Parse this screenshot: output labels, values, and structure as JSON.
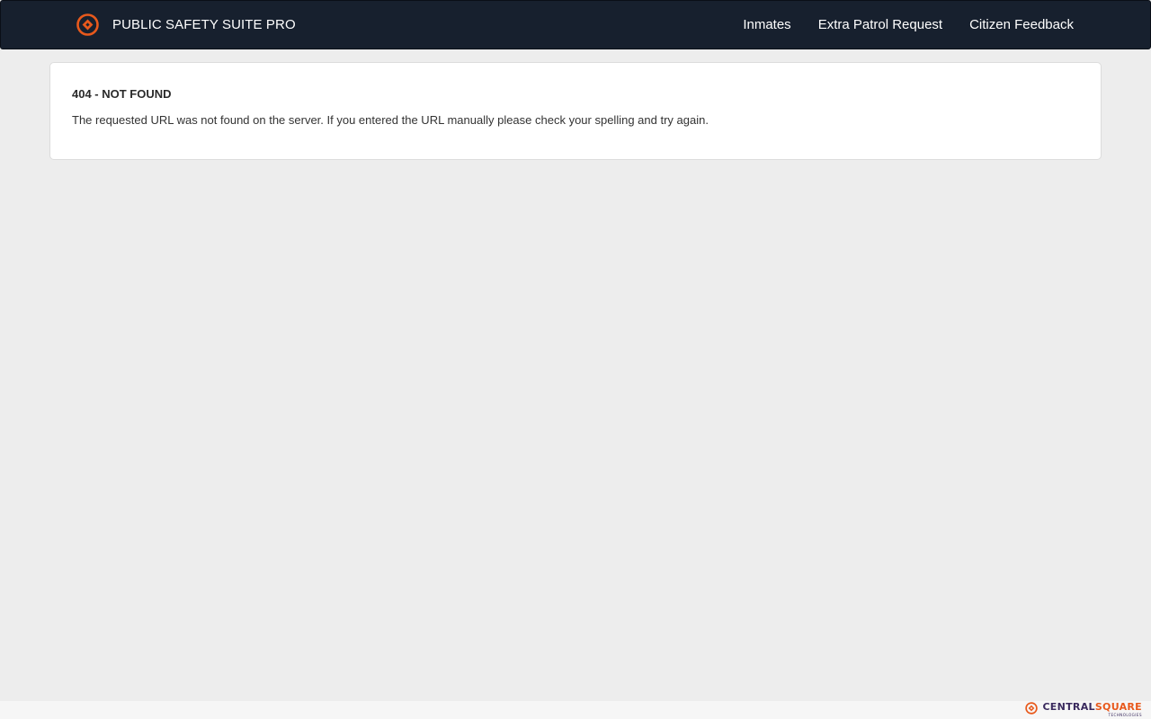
{
  "colors": {
    "navbar_bg": "#17202e",
    "page_bg": "#ededed",
    "accent_orange": "#e8591c",
    "brand_purple": "#3a2a5e"
  },
  "navbar": {
    "logo_icon": "centralsquare-logo-icon",
    "brand_title": "PUBLIC SAFETY SUITE PRO",
    "links": [
      {
        "label": "Inmates"
      },
      {
        "label": "Extra Patrol Request"
      },
      {
        "label": "Citizen Feedback"
      }
    ]
  },
  "error": {
    "title": "404 - NOT FOUND",
    "message": "The requested URL was not found on the server. If you entered the URL manually please check your spelling and try again."
  },
  "footer": {
    "logo_icon": "centralsquare-logo-icon",
    "brand_part1": "CENTRAL",
    "brand_part2": "SQUARE",
    "brand_sub": "TECHNOLOGIES"
  }
}
